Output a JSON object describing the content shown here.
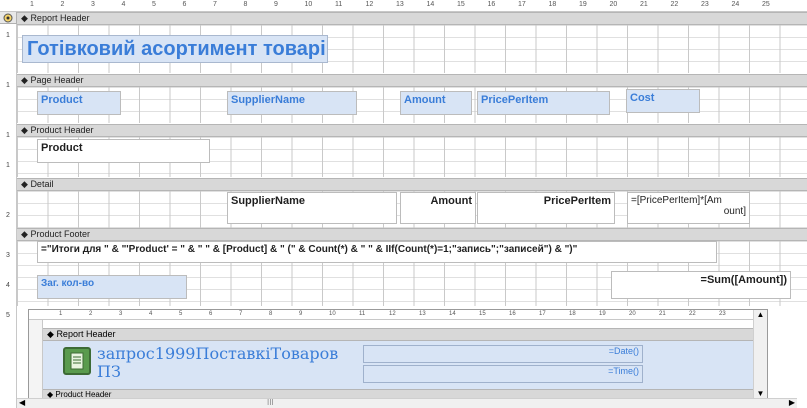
{
  "top_ruler": [
    "1",
    "2",
    "3",
    "4",
    "5",
    "6",
    "7",
    "8",
    "9",
    "10",
    "11",
    "12",
    "13",
    "14",
    "15",
    "16",
    "17",
    "18",
    "19",
    "20",
    "21",
    "22",
    "23",
    "24",
    "25"
  ],
  "left_ruler": [
    "1",
    "1",
    "1",
    "1",
    "2",
    "3",
    "4",
    "5"
  ],
  "sections": {
    "report_header": "Report Header",
    "page_header": "Page Header",
    "product_header": "Product Header",
    "detail": "Detail",
    "product_footer": "Product Footer"
  },
  "report_title": "Готівковий асортимент товарів",
  "page_header_fields": {
    "product": "Product",
    "supplier_name": "SupplierName",
    "amount": "Amount",
    "price_per_item": "PricePerItem",
    "cost": "Cost"
  },
  "product_header_field": "Product",
  "detail_fields": {
    "supplier_name": "SupplierName",
    "amount": "Amount",
    "price_per_item": "PricePerItem",
    "cost_expr_line1": "=[PricePerItem]*[Am",
    "cost_expr_line2": "ount]"
  },
  "footer": {
    "summary_expr": "=\"Итоги для \" & \"'Product' = \" & \" \" & [Product] & \" (\" & Count(*) & \" \" & IIf(Count(*)=1;\"запись\";\"записей\") & \")\"",
    "total_label": "Заг. кол-во",
    "sum_expr": "=Sum([Amount])"
  },
  "subreport": {
    "section_label": "Report Header",
    "title_line1": "запрос1999ПоставкіТоваров",
    "title_line2": "ПЗ",
    "date_expr": "=Date()",
    "time_expr": "=Time()",
    "next_section": "Product Header",
    "ruler": [
      "1",
      "2",
      "3",
      "4",
      "5",
      "6",
      "7",
      "8",
      "9",
      "10",
      "11",
      "12",
      "13",
      "14",
      "15",
      "16",
      "17",
      "18",
      "19",
      "20",
      "21",
      "22",
      "23"
    ]
  },
  "hscroll_grip": "III"
}
